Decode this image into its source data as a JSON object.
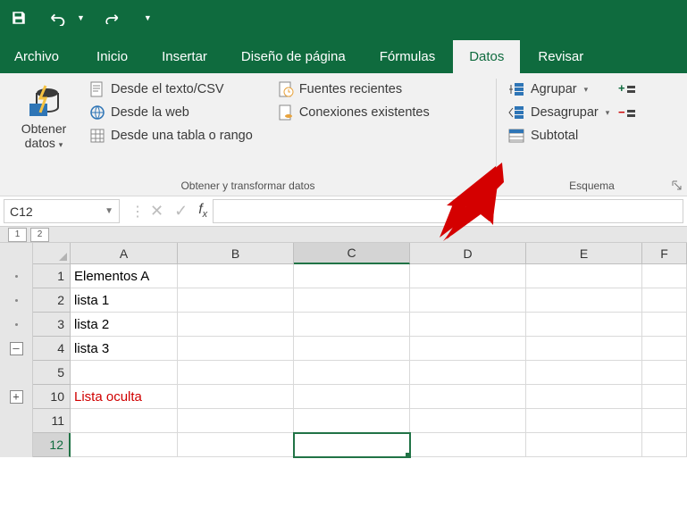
{
  "qat": {
    "save": "save-icon",
    "undo": "undo-icon",
    "redo": "redo-icon"
  },
  "tabs": {
    "file": "Archivo",
    "home": "Inicio",
    "insert": "Insertar",
    "pagelayout": "Diseño de página",
    "formulas": "Fórmulas",
    "data": "Datos",
    "review": "Revisar"
  },
  "active_tab": "data",
  "ribbon": {
    "get_transform": {
      "get_data_big": "Obtener\ndatos",
      "from_text_csv": "Desde el texto/CSV",
      "from_web": "Desde la web",
      "from_table": "Desde una tabla o rango",
      "recent_sources": "Fuentes recientes",
      "existing_conn": "Conexiones existentes",
      "group_label": "Obtener y transformar datos"
    },
    "outline_group": {
      "group": "Agrupar",
      "ungroup": "Desagrupar",
      "subtotal": "Subtotal",
      "group_label": "Esquema"
    }
  },
  "namebox": "C12",
  "formula": "",
  "outline_levels": [
    "1",
    "2"
  ],
  "columns": [
    "A",
    "B",
    "C",
    "D",
    "E",
    "F"
  ],
  "selected_col": "C",
  "selected_row": "12",
  "rows": [
    {
      "num": "1",
      "gutter": {
        "type": "dot"
      },
      "A": "Elementos A"
    },
    {
      "num": "2",
      "gutter": {
        "type": "dot"
      },
      "A": "lista 1"
    },
    {
      "num": "3",
      "gutter": {
        "type": "dot"
      },
      "A": "lista 2"
    },
    {
      "num": "4",
      "gutter": {
        "type": "box",
        "sym": "–"
      },
      "A": "lista 3"
    },
    {
      "num": "5",
      "gutter": {
        "type": "none"
      },
      "A": ""
    },
    {
      "num": "10",
      "gutter": {
        "type": "box",
        "sym": "+"
      },
      "A": "Lista oculta",
      "red": true
    },
    {
      "num": "11",
      "gutter": {
        "type": "none"
      },
      "A": ""
    },
    {
      "num": "12",
      "gutter": {
        "type": "none"
      },
      "A": "",
      "selectedC": true
    }
  ]
}
